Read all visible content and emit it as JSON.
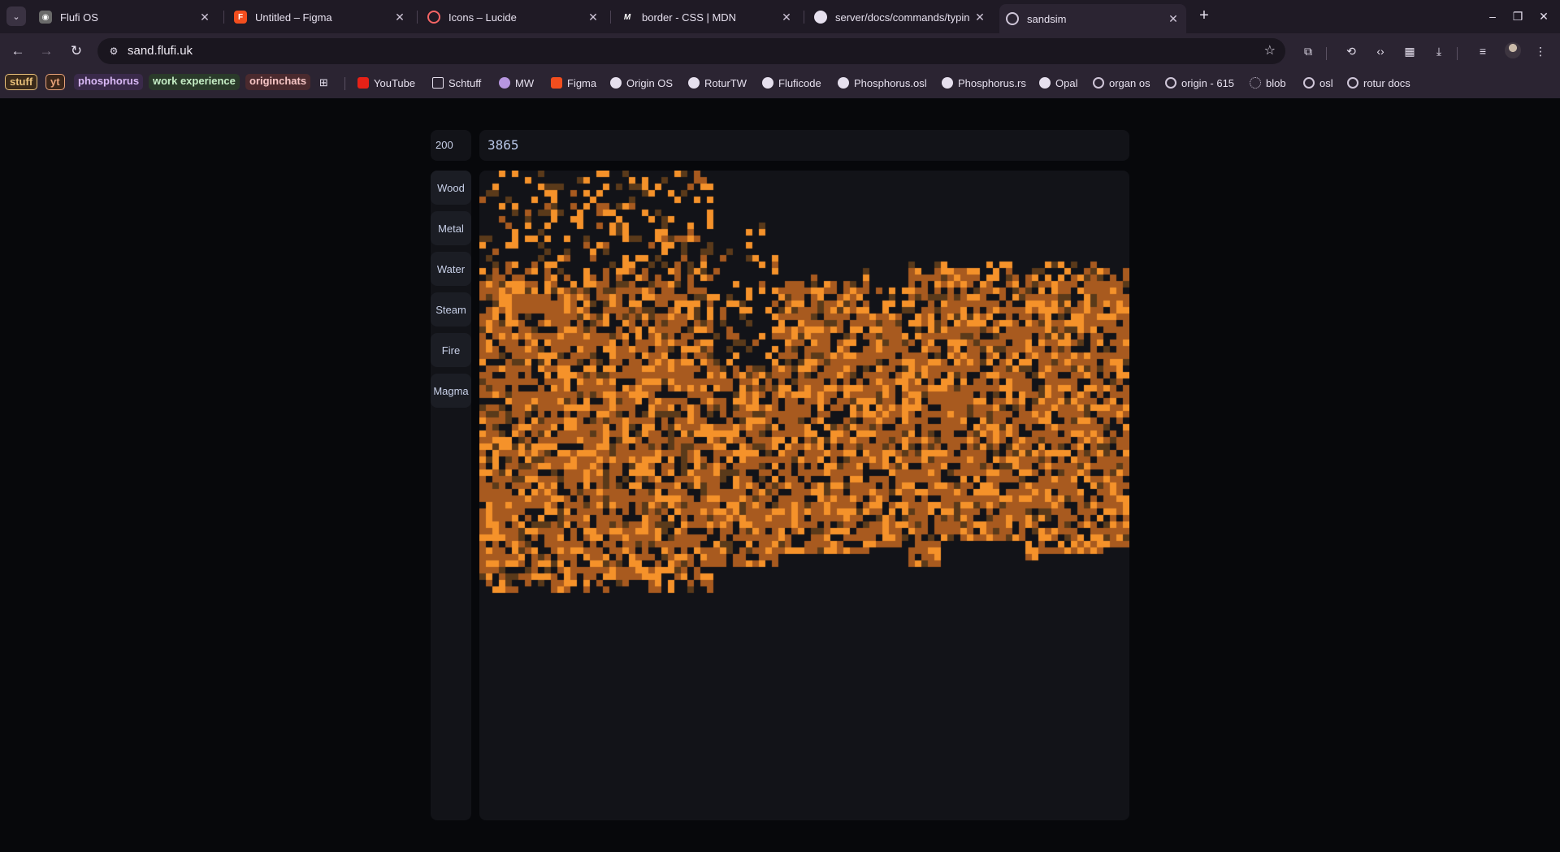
{
  "browser": {
    "tabs": [
      {
        "title": "Flufi OS",
        "icon": "flufi-icon",
        "active": false
      },
      {
        "title": "Untitled – Figma",
        "icon": "figma-icon",
        "active": false
      },
      {
        "title": "Icons – Lucide",
        "icon": "lucide-icon",
        "active": false
      },
      {
        "title": "border - CSS | MDN",
        "icon": "mdn-icon",
        "active": false
      },
      {
        "title": "server/docs/commands/typin",
        "icon": "github-icon",
        "active": false
      },
      {
        "title": "sandsim",
        "icon": "globe-icon",
        "active": true
      }
    ],
    "url": "sand.flufi.uk",
    "bookmarks_tags": [
      {
        "label": "stuff",
        "color": "#e8c07a"
      },
      {
        "label": "yt",
        "color": "#e8a37a"
      },
      {
        "label": "phosphorus",
        "color": "#c9a3e8"
      },
      {
        "label": "work experience",
        "color": "#a3d8a3"
      },
      {
        "label": "originchats",
        "color": "#e8a3a3"
      }
    ],
    "bookmarks": [
      {
        "label": "YouTube",
        "icon": "youtube-icon"
      },
      {
        "label": "Schtuff",
        "icon": "folder-icon"
      },
      {
        "label": "MW",
        "icon": "mw-icon"
      },
      {
        "label": "Figma",
        "icon": "figma-icon"
      },
      {
        "label": "Origin OS",
        "icon": "github-icon"
      },
      {
        "label": "RoturTW",
        "icon": "github-icon"
      },
      {
        "label": "Fluficode",
        "icon": "github-icon"
      },
      {
        "label": "Phosphorus.osl",
        "icon": "github-icon"
      },
      {
        "label": "Phosphorus.rs",
        "icon": "github-icon"
      },
      {
        "label": "Opal",
        "icon": "github-icon"
      },
      {
        "label": "organ os",
        "icon": "rotur-icon"
      },
      {
        "label": "origin - 615",
        "icon": "rotur-icon"
      },
      {
        "label": "blob",
        "icon": "blob-icon"
      },
      {
        "label": "osl",
        "icon": "rotur-icon"
      },
      {
        "label": "rotur docs",
        "icon": "rotur-icon"
      }
    ]
  },
  "app": {
    "brush_size": "200",
    "particle_count": "3865",
    "materials": [
      "Wood",
      "Metal",
      "Water",
      "Steam",
      "Fire",
      "Magma"
    ],
    "colors": {
      "sand_base": "#a85a1f",
      "sand_bright": "#f5922a",
      "sand_dim": "#5a3a1a",
      "panel": "#121318",
      "page_bg": "#07080b"
    }
  }
}
